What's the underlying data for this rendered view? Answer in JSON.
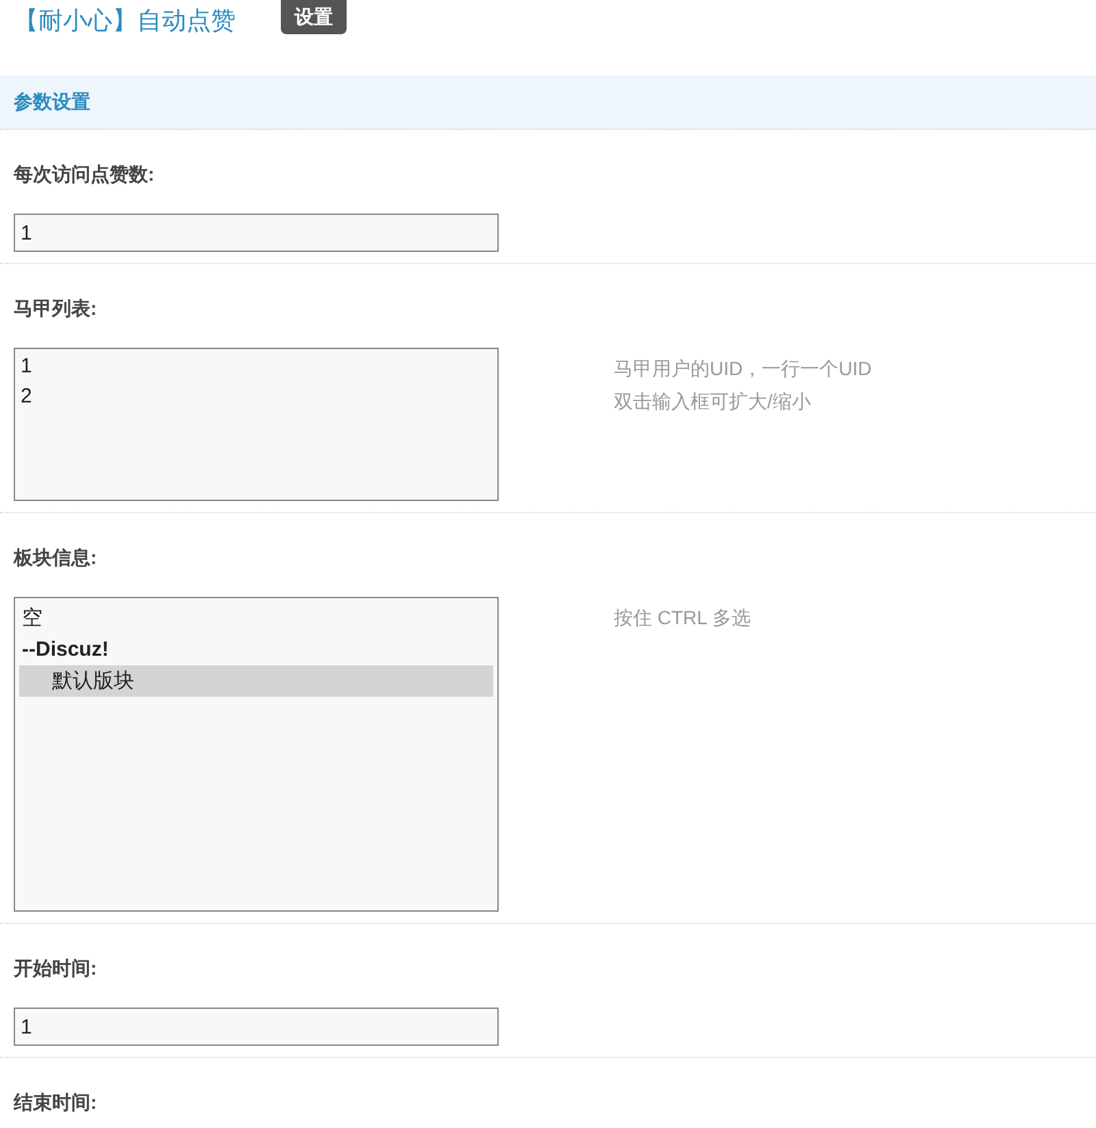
{
  "header": {
    "title": "【耐小心】自动点赞",
    "tabs": [
      {
        "label": "设置",
        "selected": true
      }
    ]
  },
  "section": {
    "title": "参数设置"
  },
  "fields": [
    {
      "kind": "text",
      "label": "每次访问点赞数:",
      "value": "1"
    },
    {
      "kind": "textarea",
      "label": "马甲列表:",
      "lines": [
        "1",
        "2"
      ],
      "hint": [
        "马甲用户的UID，一行一个UID",
        "双击输入框可扩大/缩小"
      ]
    },
    {
      "kind": "select",
      "label": "板块信息:",
      "options": [
        {
          "kind": "option",
          "label": "空",
          "selected": false
        },
        {
          "kind": "group",
          "label": "--Discuz!",
          "selected": false
        },
        {
          "kind": "option",
          "label": "默认版块",
          "selected": true,
          "indent": true
        }
      ],
      "hint": [
        "按住 CTRL 多选"
      ]
    },
    {
      "kind": "text",
      "label": "开始时间:",
      "value": "1"
    },
    {
      "kind": "label_only",
      "label": "结束时间:"
    }
  ]
}
